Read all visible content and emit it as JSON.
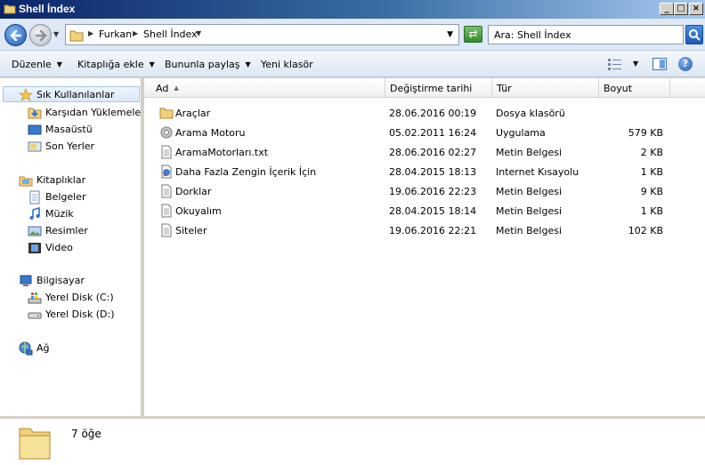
{
  "window": {
    "title": "Shell İndex"
  },
  "titlebar_buttons": {
    "minimize": "_",
    "maximize": "□",
    "close": "×"
  },
  "address": {
    "crumbs": [
      "Furkan",
      "Shell İndex"
    ]
  },
  "search": {
    "placeholder": "Ara: Shell İndex"
  },
  "toolbar": {
    "organize": "Düzenle",
    "add_to_library": "Kitaplığa ekle",
    "share_with": "Bununla paylaş",
    "new_folder": "Yeni klasör"
  },
  "help": {
    "label": "?"
  },
  "nav": {
    "favorites": {
      "label": "Sık Kullanılanlar",
      "items": [
        "Karşıdan Yüklemeler",
        "Masaüstü",
        "Son Yerler"
      ]
    },
    "libraries": {
      "label": "Kitaplıklar",
      "items": [
        "Belgeler",
        "Müzik",
        "Resimler",
        "Video"
      ]
    },
    "computer": {
      "label": "Bilgisayar",
      "items": [
        "Yerel Disk (C:)",
        "Yerel Disk (D:)"
      ]
    },
    "network": {
      "label": "Ağ"
    }
  },
  "columns": {
    "name": "Ad",
    "date": "Değiştirme tarihi",
    "type": "Tür",
    "size": "Boyut"
  },
  "files": [
    {
      "name": "Araçlar",
      "date": "28.06.2016 00:19",
      "type": "Dosya klasörü",
      "size": "",
      "icon": "folder-icon"
    },
    {
      "name": "Arama Motoru",
      "date": "05.02.2011 16:24",
      "type": "Uygulama",
      "size": "579 KB",
      "icon": "application-icon"
    },
    {
      "name": "AramaMotorları.txt",
      "date": "28.06.2016 02:27",
      "type": "Metin Belgesi",
      "size": "2 KB",
      "icon": "text-file-icon"
    },
    {
      "name": "Daha Fazla Zengin İçerik İçin",
      "date": "28.04.2015 18:13",
      "type": "Internet Kısayolu",
      "size": "1 KB",
      "icon": "internet-shortcut-icon"
    },
    {
      "name": "Dorklar",
      "date": "19.06.2016 22:23",
      "type": "Metin Belgesi",
      "size": "9 KB",
      "icon": "text-file-icon"
    },
    {
      "name": "Okuyalım",
      "date": "28.04.2015 18:14",
      "type": "Metin Belgesi",
      "size": "1 KB",
      "icon": "text-file-icon"
    },
    {
      "name": "Siteler",
      "date": "19.06.2016 22:21",
      "type": "Metin Belgesi",
      "size": "102 KB",
      "icon": "text-file-icon"
    }
  ],
  "status": {
    "item_count": "7 öğe"
  },
  "colors": {
    "title_start": "#0a246a",
    "title_end": "#a6caf0",
    "selection": "#d9e8fb"
  }
}
